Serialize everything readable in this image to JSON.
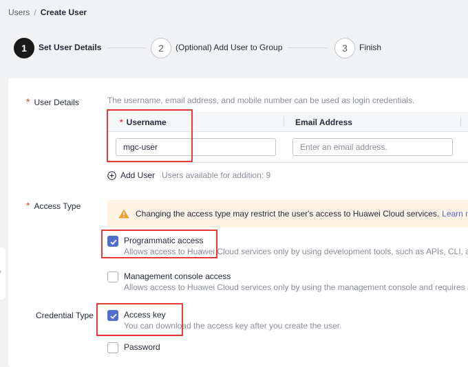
{
  "breadcrumb": {
    "parent": "Users",
    "separator": "/",
    "current": "Create User"
  },
  "steps": [
    {
      "number": "1",
      "label": "Set User Details"
    },
    {
      "number": "2",
      "label": "(Optional) Add User to Group"
    },
    {
      "number": "3",
      "label": "Finish"
    }
  ],
  "user_details": {
    "label": "User Details",
    "hint": "The username, email address, and mobile number can be used as login credentials.",
    "columns": {
      "username": "Username",
      "email": "Email Address"
    },
    "username_value": "mgc-user",
    "email_placeholder": "Enter an email address.",
    "add_user_label": "Add User",
    "available_text": "Users available for addition: 9"
  },
  "access_type": {
    "label": "Access Type",
    "alert_text": "Changing the access type may restrict the user's access to Huawei Cloud services.",
    "alert_link": "Learn m",
    "options": [
      {
        "title": "Programmatic access",
        "desc": "Allows access to Huawei Cloud services only by using development tools, such as APIs, CLI, a",
        "checked": true
      },
      {
        "title": "Management console access",
        "desc": "Allows access to Huawei Cloud services only by using the management console and requires a",
        "checked": false
      }
    ]
  },
  "credential_type": {
    "label": "Credential Type",
    "options": [
      {
        "title": "Access key",
        "desc": "You can download the access key after you create the user.",
        "checked": true
      },
      {
        "title": "Password",
        "desc": "",
        "checked": false
      }
    ]
  },
  "colors": {
    "accent": "#526ecc",
    "highlight": "#e53935",
    "required": "#e0403a",
    "warning": "#f59a23"
  },
  "icons": {
    "add": "plus-circle-icon",
    "warning": "warning-triangle-icon",
    "check": "check-icon",
    "side": "chevron-right-icon"
  }
}
